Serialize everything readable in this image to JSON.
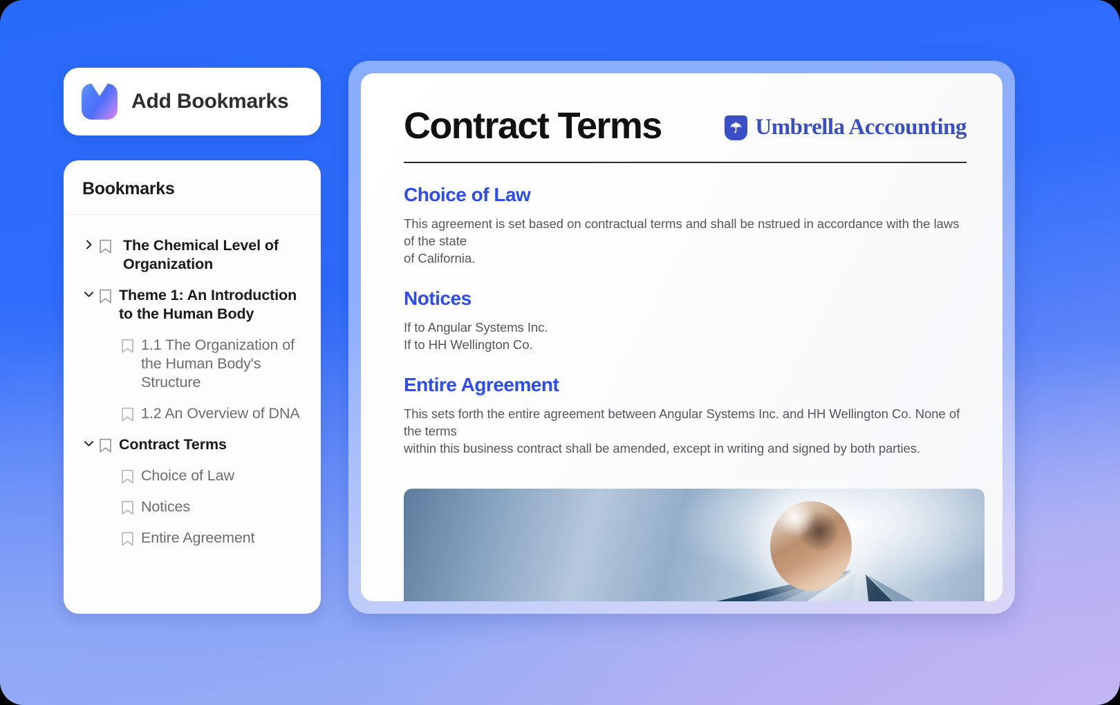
{
  "theme": {
    "bg_blue": "#2a6afb",
    "bg_periwinkle": "#93abf6",
    "bg_lavender": "#c3b4f2",
    "heading_blue": "#2c4bf2",
    "logo_blue": "#3a4fc6",
    "body_gray": "#56565c"
  },
  "sidebar": {
    "add_button": {
      "label": "Add Bookmarks",
      "icon": "bookmark-app-icon"
    },
    "panel_title": "Bookmarks",
    "items": [
      {
        "label": "The Chemical Level of Organization",
        "level": "top",
        "expanded": false,
        "chevron": "chevron-right-icon",
        "icon": "bookmark-outline-icon"
      },
      {
        "label": "Theme 1: An Introduction to the Human Body",
        "level": "top",
        "expanded": true,
        "chevron": "chevron-down-icon",
        "icon": "bookmark-outline-icon"
      },
      {
        "label": "1.1 The Organization of the Human Body's Structure",
        "level": "sub",
        "expanded": null,
        "chevron": null,
        "icon": "bookmark-outline-icon"
      },
      {
        "label": "1.2 An Overview of DNA",
        "level": "sub",
        "expanded": null,
        "chevron": null,
        "icon": "bookmark-outline-icon"
      },
      {
        "label": "Contract Terms",
        "level": "top",
        "expanded": true,
        "chevron": "chevron-down-icon",
        "icon": "bookmark-outline-icon"
      },
      {
        "label": "Choice of Law",
        "level": "sub",
        "expanded": null,
        "chevron": null,
        "icon": "bookmark-outline-icon"
      },
      {
        "label": "Notices",
        "level": "sub",
        "expanded": null,
        "chevron": null,
        "icon": "bookmark-outline-icon"
      },
      {
        "label": "Entire Agreement",
        "level": "sub",
        "expanded": null,
        "chevron": null,
        "icon": "bookmark-outline-icon"
      }
    ]
  },
  "document": {
    "title": "Contract Terms",
    "logo": {
      "text": "Umbrella Acccounting",
      "icon": "umbrella-icon"
    },
    "sections": [
      {
        "heading": "Choice of Law",
        "lines": [
          "This agreement is set based on contractual terms and shall be nstrued in accordance with the laws of the state",
          "of California."
        ]
      },
      {
        "heading": "Notices",
        "lines": [
          "If to Angular Systems Inc.",
          "If to HH Wellington Co."
        ]
      },
      {
        "heading": "Entire Agreement",
        "lines": [
          "This sets forth the entire agreement between Angular Systems Inc. and HH Wellington Co. None of the terms",
          "within this business contract shall be amended, except in writing and signed by both parties."
        ]
      }
    ],
    "figure": {
      "description": "Abstract 3D render: copper sphere with white glow over blue-gray gradient and dark navy angular shards"
    }
  }
}
